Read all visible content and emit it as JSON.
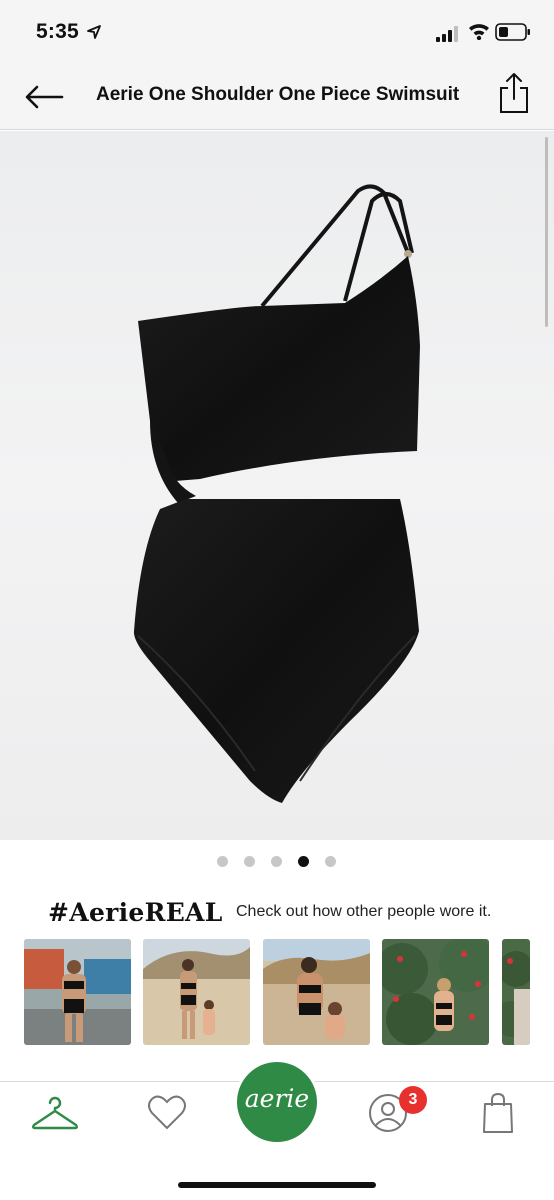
{
  "status_bar": {
    "time": "5:35"
  },
  "header": {
    "title": "Aerie One Shoulder One Piece Swimsuit"
  },
  "icons": {
    "back": "arrow-left-icon",
    "share": "share-icon",
    "closet": "hanger-icon",
    "favorites": "heart-icon",
    "account": "user-icon",
    "bag": "shopping-bag-icon"
  },
  "gallery": {
    "image_count": 5,
    "active_index": 3
  },
  "aerie_real": {
    "heading": "#AerieREAL",
    "subtext": "Check out how other people wore it."
  },
  "tab_bar": {
    "logo_text": "aerie",
    "account_badge": "3"
  },
  "colors": {
    "brand_green": "#2f8a45",
    "badge_red": "#e8312f"
  }
}
